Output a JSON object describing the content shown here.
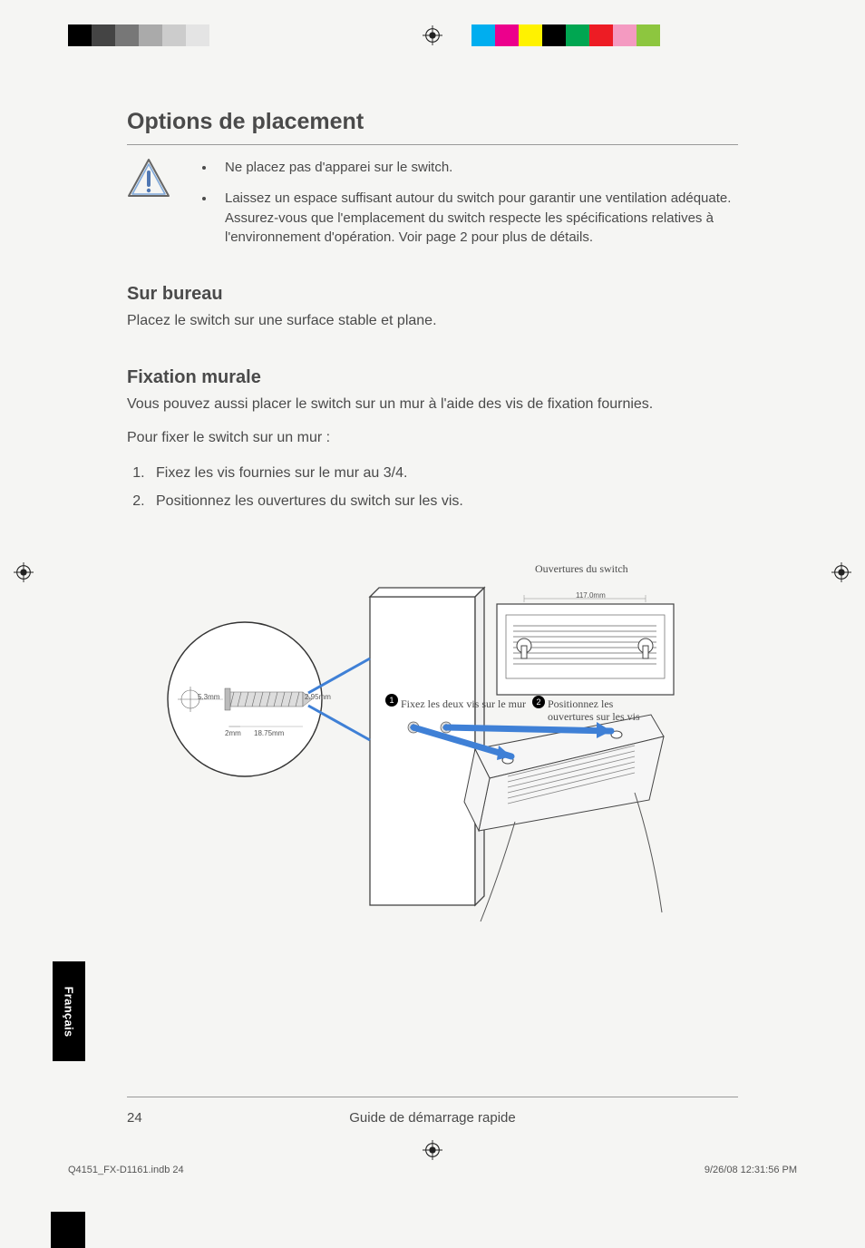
{
  "title": "Options de placement",
  "warnings": [
    "Ne placez pas d'apparei sur le switch.",
    "Laissez un espace suffisant autour du switch pour garantir une ventilation adéquate. Assurez-vous que l'emplacement du switch respecte les spécifications relatives à l'environnement d'opération. Voir page 2 pour plus de détails."
  ],
  "section1": {
    "heading": "Sur bureau",
    "body": "Placez le switch sur une surface stable et plane."
  },
  "section2": {
    "heading": "Fixation murale",
    "intro": "Vous pouvez aussi placer le switch sur un mur à l'aide des vis de fixation fournies.",
    "lead": "Pour fixer le switch sur un mur :",
    "steps": [
      "Fixez les vis fournies sur le mur au 3/4.",
      "Positionnez les ouvertures du switch sur les vis."
    ]
  },
  "figure": {
    "topLabel": "Ouvertures du switch",
    "dimTop": "117.0mm",
    "screw": {
      "d1": "5.3mm",
      "d2": "2.95mm",
      "d3": "2mm",
      "d4": "18.75mm"
    },
    "step1": "Fixez les deux vis sur le mur",
    "step2a": "Positionnez les",
    "step2b": "ouvertures sur les vis"
  },
  "langTab": "Français",
  "footer": {
    "page": "24",
    "title": "Guide de démarrage rapide"
  },
  "printFooter": {
    "file": "Q4151_FX-D1161.indb   24",
    "timestamp": "9/26/08   12:31:56 PM"
  },
  "cropColors": {
    "left": [
      "#000",
      "#444",
      "#777",
      "#aaa",
      "#ccc",
      "#e4e4e4"
    ],
    "right": [
      "#00aeef",
      "#ec008c",
      "#fff200",
      "#000",
      "#00a651",
      "#ed1c24",
      "#f49ac1",
      "#8dc63f"
    ]
  }
}
